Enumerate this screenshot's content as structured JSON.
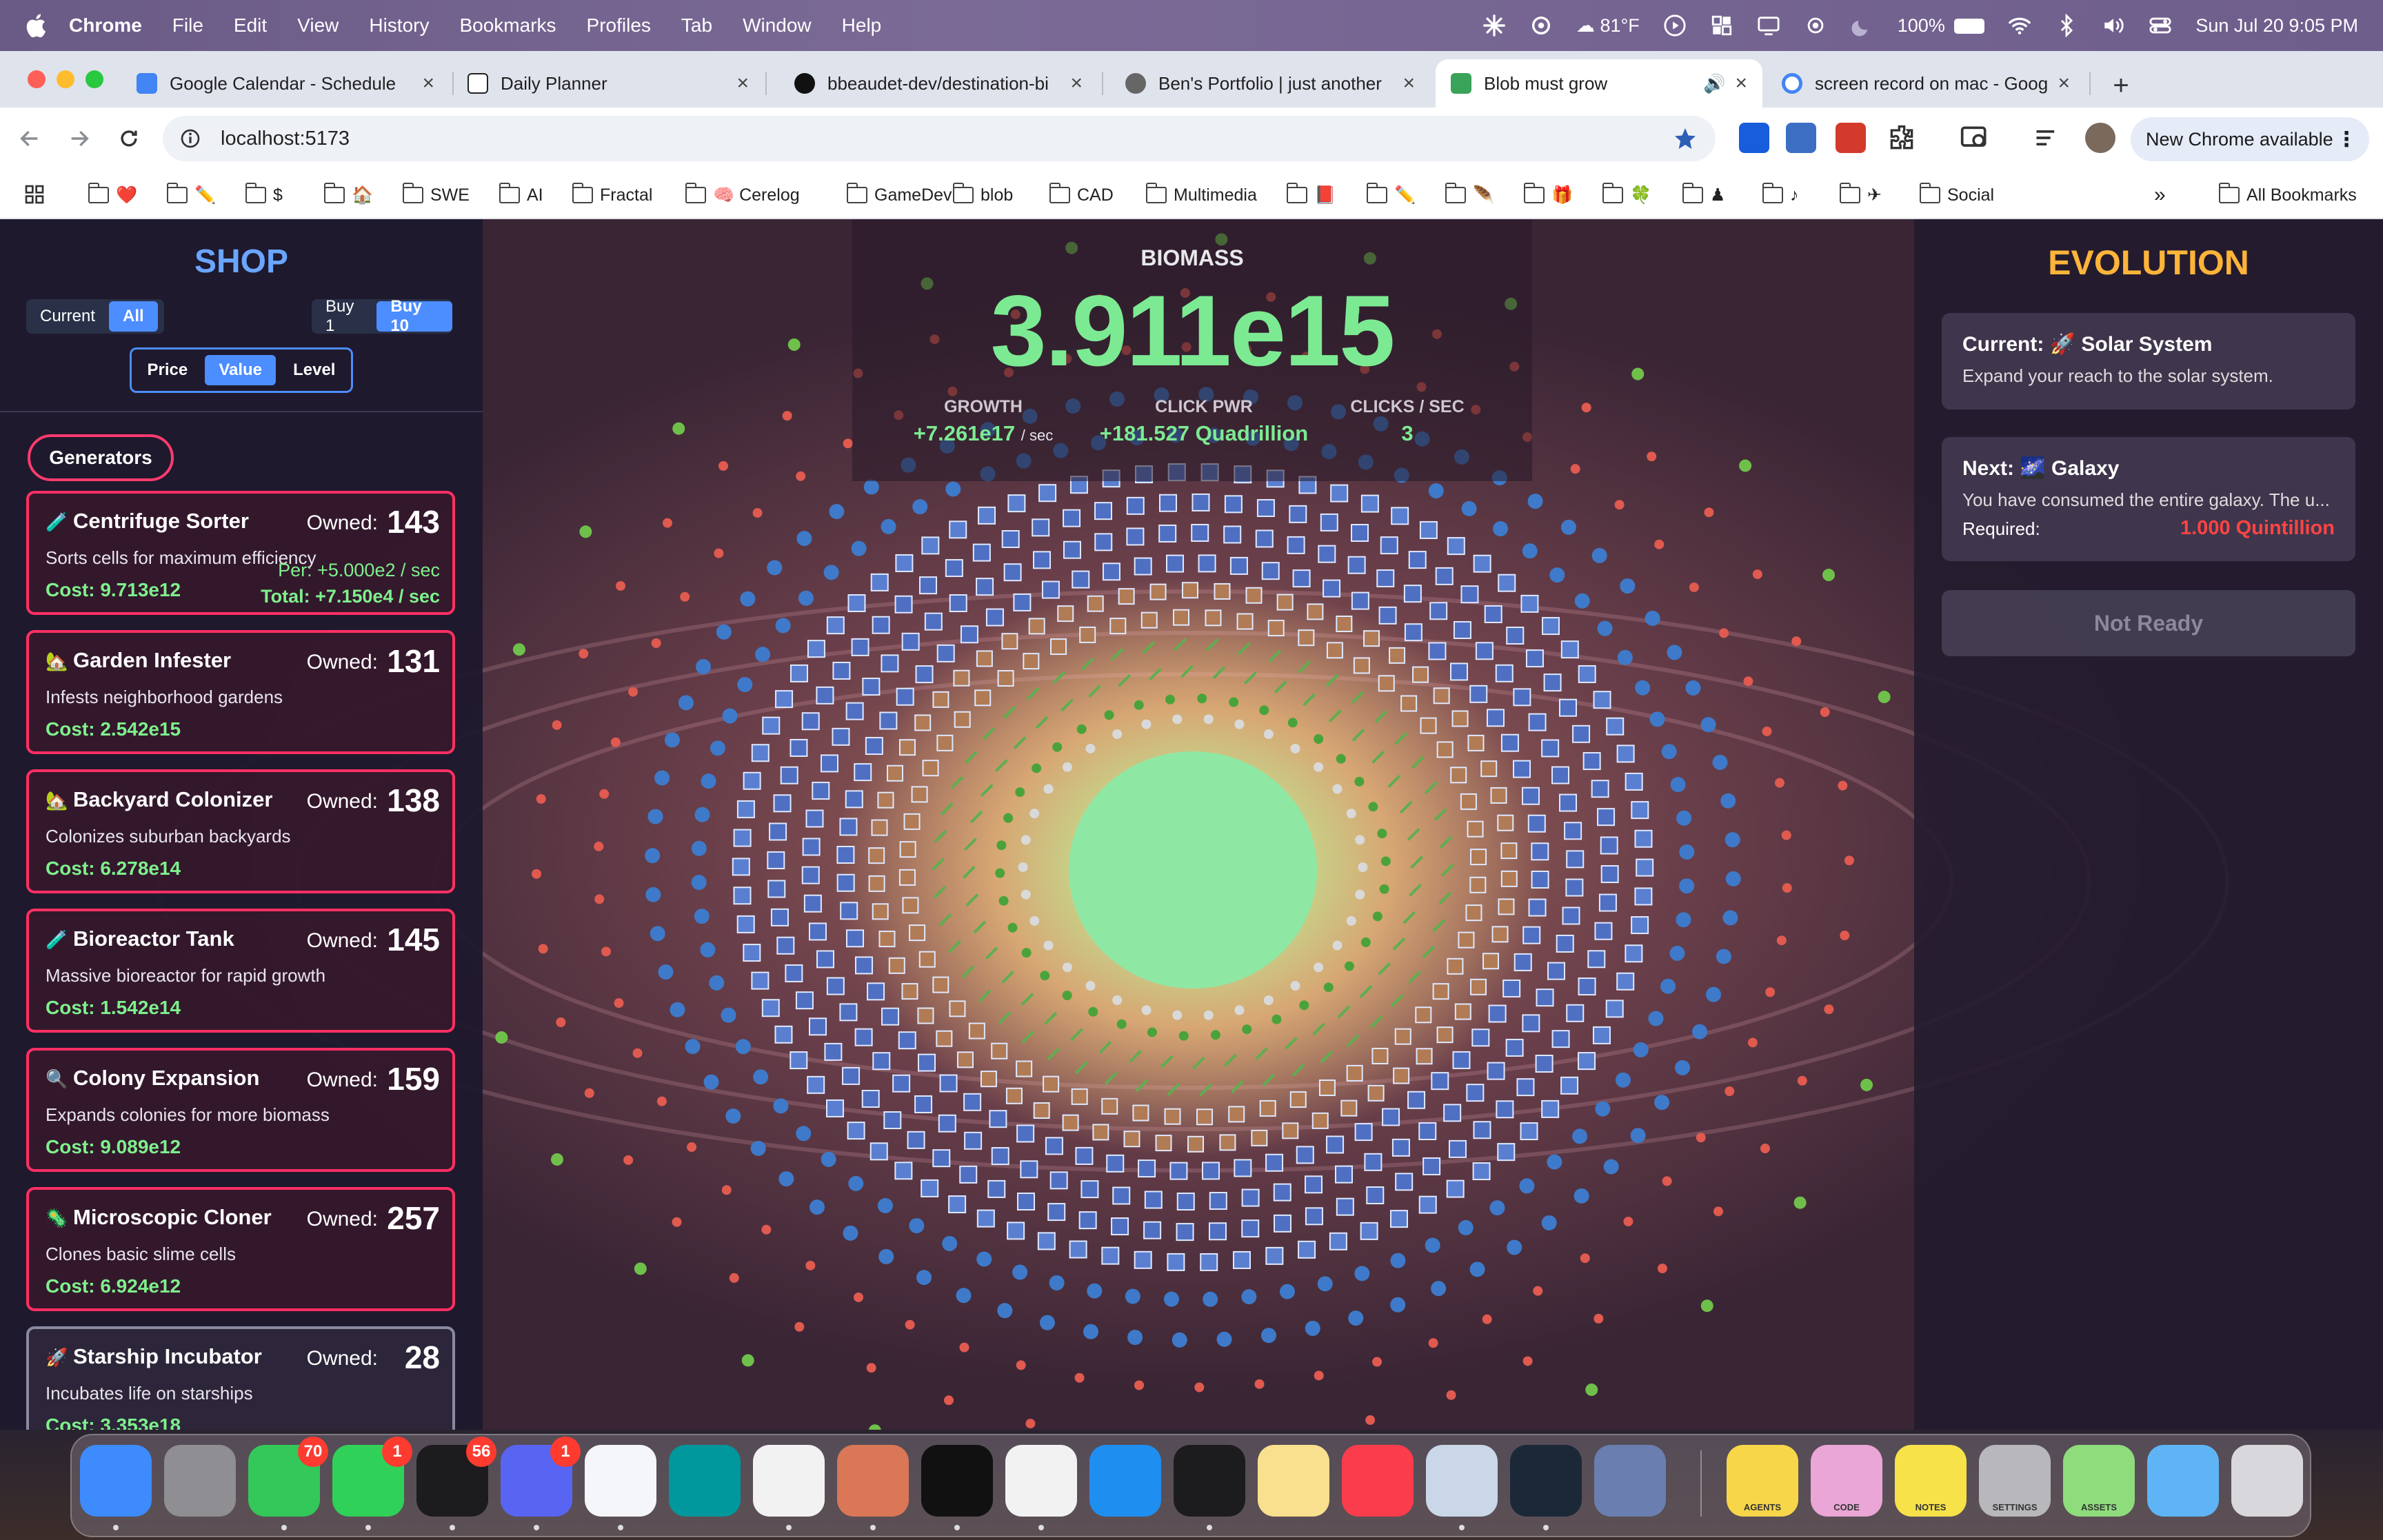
{
  "menubar": {
    "app": "Chrome",
    "items": [
      "File",
      "Edit",
      "View",
      "History",
      "Bookmarks",
      "Profiles",
      "Tab",
      "Window",
      "Help"
    ],
    "weather": "81°F",
    "battery": "100%",
    "datetime": "Sun Jul 20  9:05 PM"
  },
  "tabs": [
    {
      "title": "Google Calendar - Schedule",
      "favicon_color": "#4285f4"
    },
    {
      "title": "Daily Planner",
      "favicon_color": "#222222"
    },
    {
      "title": "bbeaudet-dev/destination-bi",
      "favicon_color": "#111111"
    },
    {
      "title": "Ben's Portfolio | just another",
      "favicon_color": "#555555"
    },
    {
      "title": "Blob must grow",
      "favicon_color": "#3aa35a",
      "active": true
    },
    {
      "title": "screen record on mac - Goog",
      "favicon_color": "#4285f4"
    }
  ],
  "toolbar": {
    "url": "localhost:5173",
    "new_chrome": "New Chrome available"
  },
  "bookmarks": [
    {
      "label": "❤️"
    },
    {
      "label": "✏️"
    },
    {
      "label": "$"
    },
    {
      "label": "🏠"
    },
    {
      "label": "SWE"
    },
    {
      "label": "AI"
    },
    {
      "label": "Fractal"
    },
    {
      "label": "🧠 Cerelog"
    },
    {
      "label": "GameDev"
    },
    {
      "label": "blob"
    },
    {
      "label": "CAD"
    },
    {
      "label": "Multimedia"
    },
    {
      "label": "📕"
    },
    {
      "label": "✏️"
    },
    {
      "label": "🪶"
    },
    {
      "label": "🎁"
    },
    {
      "label": "🍀"
    },
    {
      "label": "♟"
    },
    {
      "label": "♪"
    },
    {
      "label": "✈"
    },
    {
      "label": "Social"
    }
  ],
  "bookmarks_more": "»",
  "bookmarks_all": "All Bookmarks",
  "shop": {
    "title": "SHOP",
    "filter": {
      "current": "Current",
      "all": "All"
    },
    "buy": {
      "one": "Buy 1",
      "ten": "Buy 10"
    },
    "sort": {
      "price": "Price",
      "value": "Value",
      "level": "Level"
    },
    "category": "Generators",
    "owned_label": "Owned:",
    "generators": [
      {
        "icon": "🧪",
        "name": "Centrifuge Sorter",
        "owned": "143",
        "desc": "Sorts cells for maximum efficiency",
        "cost": "Cost: 9.713e12",
        "per": "Per: +5.000e2 / sec",
        "total": "Total: +7.150e4 / sec"
      },
      {
        "icon": "🏡",
        "name": "Garden Infester",
        "owned": "131",
        "desc": "Infests neighborhood gardens",
        "cost": "Cost: 2.542e15"
      },
      {
        "icon": "🏡",
        "name": "Backyard Colonizer",
        "owned": "138",
        "desc": "Colonizes suburban backyards",
        "cost": "Cost: 6.278e14"
      },
      {
        "icon": "🧪",
        "name": "Bioreactor Tank",
        "owned": "145",
        "desc": "Massive bioreactor for rapid growth",
        "cost": "Cost: 1.542e14"
      },
      {
        "icon": "🔍",
        "name": "Colony Expansion",
        "owned": "159",
        "desc": "Expands colonies for more biomass",
        "cost": "Cost: 9.089e12"
      },
      {
        "icon": "🦠",
        "name": "Microscopic Cloner",
        "owned": "257",
        "desc": "Clones basic slime cells",
        "cost": "Cost: 6.924e12"
      },
      {
        "icon": "🚀",
        "name": "Starship Incubator",
        "owned": "28",
        "desc": "Incubates life on starships",
        "cost": "Cost: 3.353e18"
      }
    ]
  },
  "stats": {
    "biomass_label": "BIOMASS",
    "biomass": "3.911e15",
    "growth_label": "GROWTH",
    "growth": "+7.261e17",
    "growth_unit": "/ sec",
    "click_label": "CLICK PWR",
    "click": "+181.527 Quadrillion",
    "cps_label": "CLICKS / SEC",
    "cps": "3"
  },
  "evolution": {
    "title": "EVOLUTION",
    "current_title": "Current: 🚀 Solar System",
    "current_desc": "Expand your reach to the solar system.",
    "next_title": "Next: 🌌 Galaxy",
    "next_desc": "You have consumed the entire galaxy. The u...",
    "required_label": "Required:",
    "required": "1.000 Quintillion",
    "button": "Not Ready"
  },
  "dock": [
    {
      "name": "Finder",
      "color": "#3d8bfd"
    },
    {
      "name": "System Settings",
      "color": "#8e8e93"
    },
    {
      "name": "Messages",
      "color": "#34c759",
      "badge": "70"
    },
    {
      "name": "FaceTime",
      "color": "#30d158",
      "badge": "1"
    },
    {
      "name": "Layers",
      "color": "#1c1c1e",
      "badge": "56"
    },
    {
      "name": "Discord",
      "color": "#5865f2",
      "badge": "1"
    },
    {
      "name": "VS Code",
      "color": "#f4f6fa"
    },
    {
      "name": "Arduino",
      "color": "#00979d"
    },
    {
      "name": "ChatGPT",
      "color": "#f2f2f2"
    },
    {
      "name": "Claude",
      "color": "#d97757"
    },
    {
      "name": "Unity",
      "color": "#111111"
    },
    {
      "name": "Chrome",
      "color": "#f2f2f2"
    },
    {
      "name": "Safari",
      "color": "#1f8ef1"
    },
    {
      "name": "Terminal",
      "color": "#1c1c1e"
    },
    {
      "name": "Notes",
      "color": "#f8e08e"
    },
    {
      "name": "Music",
      "color": "#fa3c4c"
    },
    {
      "name": "Preview",
      "color": "#c9d7e8"
    },
    {
      "name": "Steam",
      "color": "#1b2838"
    },
    {
      "name": "QuickTime",
      "color": "#6a7fb0"
    },
    {
      "name": "AGENTS",
      "color": "#f7d64a"
    },
    {
      "name": "CODE",
      "color": "#e9a6d6"
    },
    {
      "name": "NOTES",
      "color": "#f7e24a"
    },
    {
      "name": "SETTINGS",
      "color": "#b8b8bc"
    },
    {
      "name": "ASSETS",
      "color": "#8fdc7c"
    },
    {
      "name": "Downloads",
      "color": "#5fb4f5"
    },
    {
      "name": "Trash",
      "color": "#d8d8dc"
    }
  ]
}
